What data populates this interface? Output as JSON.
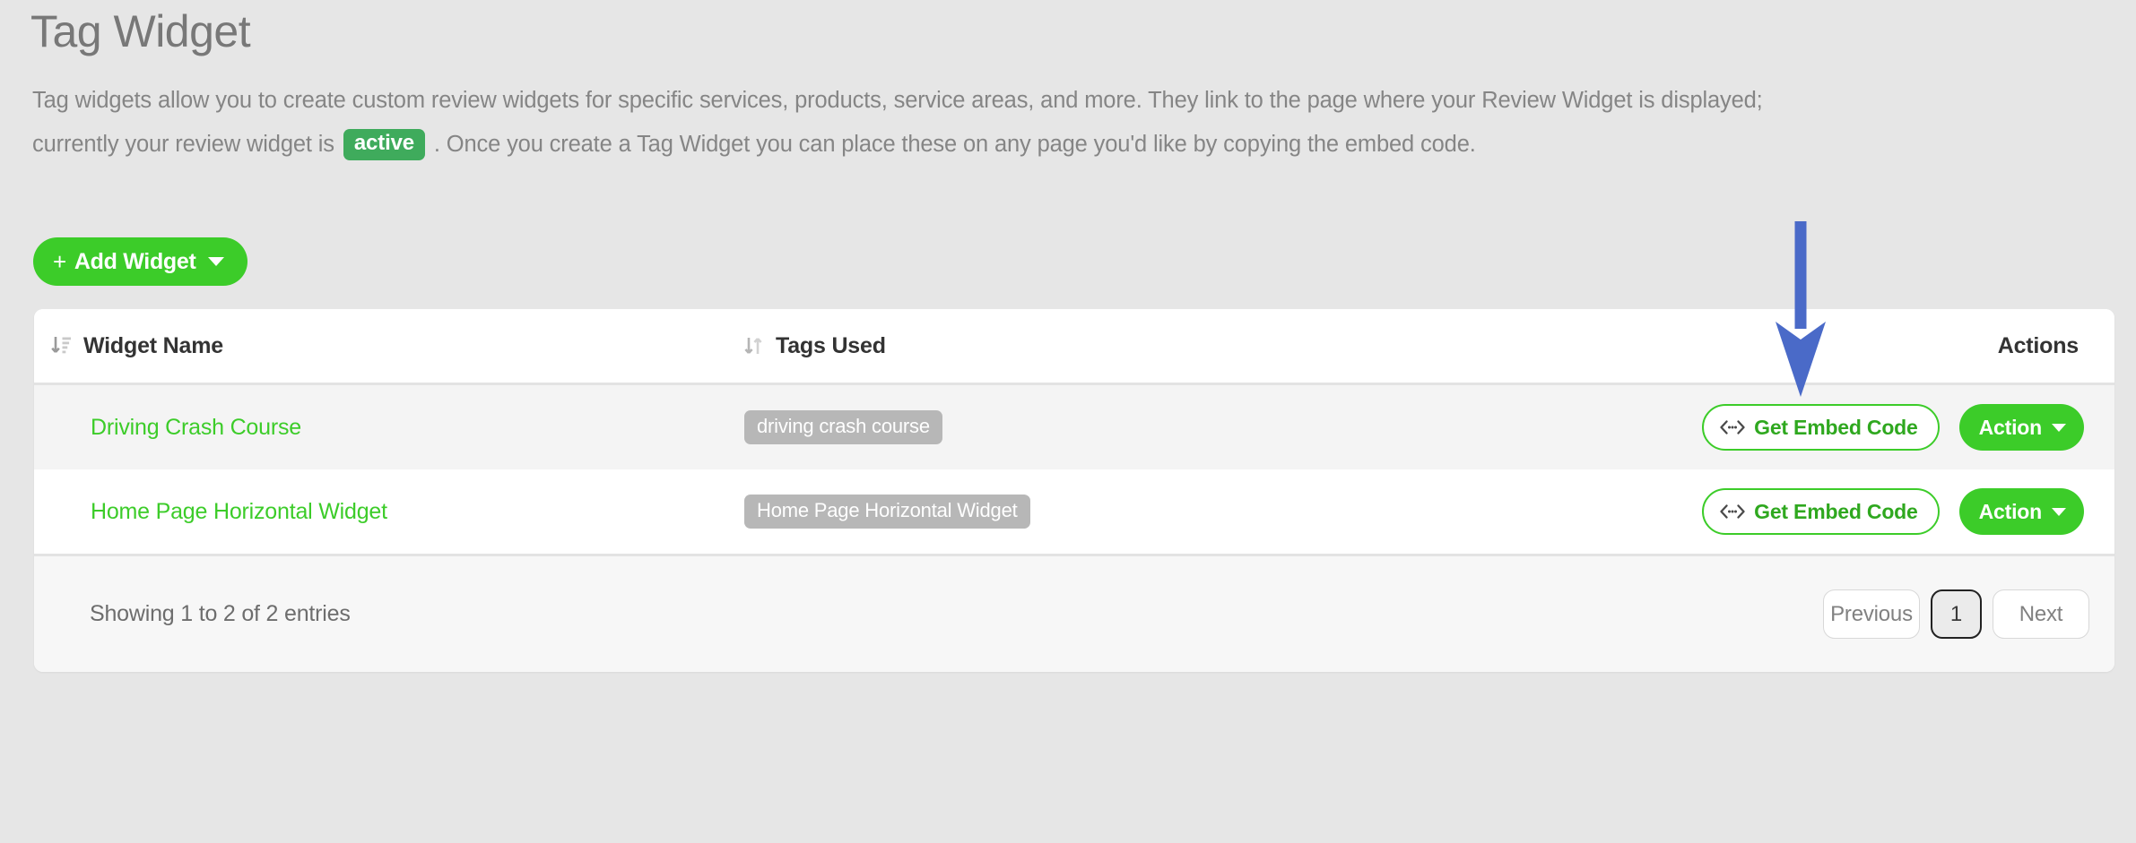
{
  "header": {
    "title": "Tag Widget",
    "description_part1": "Tag widgets allow you to create custom review widgets for specific services, products, service areas, and more. They link to the page where your Review Widget is displayed; currently your review widget is",
    "status_badge": "active",
    "description_part2": ". Once you create a Tag Widget you can place these on any page you'd like by copying the embed code."
  },
  "toolbar": {
    "add_widget_label": "Add Widget",
    "add_widget_plus": "+",
    "add_widget_icon": "chevron-down-icon"
  },
  "table": {
    "columns": [
      {
        "label": "Widget Name",
        "sort_icon": "sort-amount-down-icon",
        "sort_state": "descending"
      },
      {
        "label": "Tags Used",
        "sort_icon": "sort-updown-icon",
        "sort_state": "unsorted"
      },
      {
        "label": "Actions",
        "sort_icon": "",
        "sort_state": "none"
      }
    ],
    "rows": [
      {
        "name": "Driving Crash Course",
        "tag": "driving crash course",
        "embed_label": "Get Embed Code",
        "embed_icon": "code-embed-icon",
        "action_label": "Action",
        "action_icon": "chevron-down-icon"
      },
      {
        "name": "Home Page Horizontal Widget",
        "tag": "Home Page Horizontal Widget",
        "embed_label": "Get Embed Code",
        "embed_icon": "code-embed-icon",
        "action_label": "Action",
        "action_icon": "chevron-down-icon"
      }
    ]
  },
  "footer": {
    "showing": "Showing 1 to 2 of 2 entries",
    "previous_label": "Previous",
    "page_number": "1",
    "next_label": "Next"
  },
  "annotation": {
    "type": "arrow-down",
    "color": "#4a6ac8"
  },
  "colors": {
    "page_background": "#e6e6e6",
    "brand_green": "#3ccc29",
    "badge_green": "#3fab5c",
    "tag_gray": "#b7b7b7",
    "annotation_blue": "#4a6ac8"
  }
}
